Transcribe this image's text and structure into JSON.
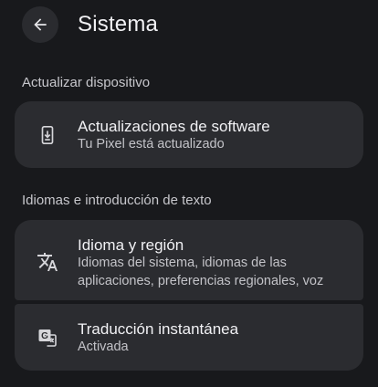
{
  "header": {
    "title": "Sistema"
  },
  "sections": [
    {
      "label": "Actualizar dispositivo",
      "items": [
        {
          "title": "Actualizaciones de software",
          "subtitle": "Tu Pixel está actualizado",
          "icon": "system-update-icon"
        }
      ]
    },
    {
      "label": "Idiomas e introducción de texto",
      "items": [
        {
          "title": "Idioma y región",
          "subtitle_line1": "Idiomas del sistema, idiomas de las",
          "subtitle_line2": "aplicaciones, preferencias regionales, voz",
          "icon": "translate-icon"
        },
        {
          "title": "Traducción instantánea",
          "subtitle": "Activada",
          "icon": "live-translate-icon"
        }
      ]
    }
  ]
}
